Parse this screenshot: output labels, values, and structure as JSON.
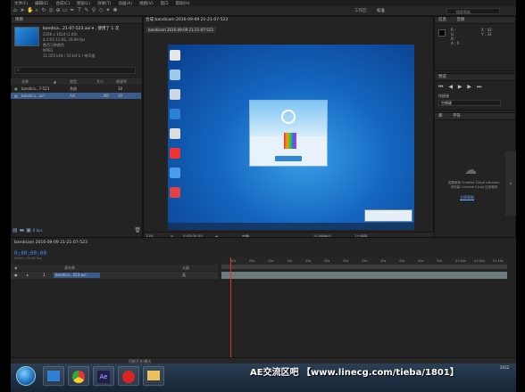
{
  "menu": [
    "文件(F)",
    "编辑(E)",
    "合成(C)",
    "图层(L)",
    "效果(T)",
    "动画(A)",
    "视图(V)",
    "窗口",
    "帮助(H)"
  ],
  "toolbar": {
    "workspace_label": "工作区:",
    "workspace_value": "标准",
    "search_placeholder": "搜索帮助"
  },
  "project": {
    "tab": "项目",
    "title": "bandica...21-07-523.avi ▾ , 使用了 1 次",
    "info": [
      "2356 x 1024 (1.00)",
      "Δ 0:01:11:06, 29.99 fps",
      "数百万种颜色",
      "MPEG",
      "11,025 kHz / 16 bit U / 单声道"
    ],
    "search_placeholder": "",
    "columns": [
      "名称",
      "▲",
      "类型",
      "大小",
      "帧速率"
    ],
    "rows": [
      {
        "name": "bandica...7-523",
        "type": "合成",
        "size": "",
        "fps": "30"
      },
      {
        "name": "bandica...avi",
        "type": "AVI",
        "size": "...MB",
        "fps": "30"
      }
    ]
  },
  "composition": {
    "tab": "合成 bandicam 2016-09-09 21-21-07-523",
    "sub_tab": "bandicam 2016-09-09 21-21-07-523",
    "viewer_zoom": "33%",
    "viewer_time": "0:00:00:00",
    "viewer_quality": "完整",
    "viewer_camera": "活动摄像机",
    "viewer_views": "1个视图"
  },
  "info_panel": {
    "tab1": "信息",
    "tab2": "音频",
    "coords": [
      "X : 42",
      "Y : 33"
    ],
    "values": [
      "R :",
      "G :",
      "B :",
      "A : 0"
    ]
  },
  "preview_panel": {
    "tab": "预览",
    "shortcut_label": "快捷键",
    "shortcut_value": "空格键"
  },
  "library_panel": {
    "tab": "库",
    "tab2": "字符",
    "message_line1": "若要使用 Creative Cloud Libraries,",
    "message_line2": "请安装 Creative Cloud 应用程序",
    "link": "立即获取"
  },
  "timeline": {
    "tab": "bandicam 2016-09-09 21-21-07-523",
    "timecode": "0;00;00;00",
    "fps": "00000 (30.00 fps)",
    "columns": [
      "源名称",
      "父级"
    ],
    "layer": {
      "index": "1",
      "name": "bandica...523.avi",
      "parent": "无"
    },
    "ruler": [
      "00s",
      "05s",
      "10s",
      "15s",
      "20s",
      "25s",
      "30s",
      "35s",
      "40s",
      "45s",
      "50s",
      "55s",
      "01:00s",
      "01:05s",
      "01:10s"
    ],
    "bottom_label": "切换开关/模式"
  },
  "taskbar": {
    "apps": [
      "explorer",
      "chrome",
      "ae",
      "rec",
      "folder"
    ]
  },
  "watermark": "AE交流区吧 【www.linecg.com/tieba/1801】",
  "tray": "2012"
}
